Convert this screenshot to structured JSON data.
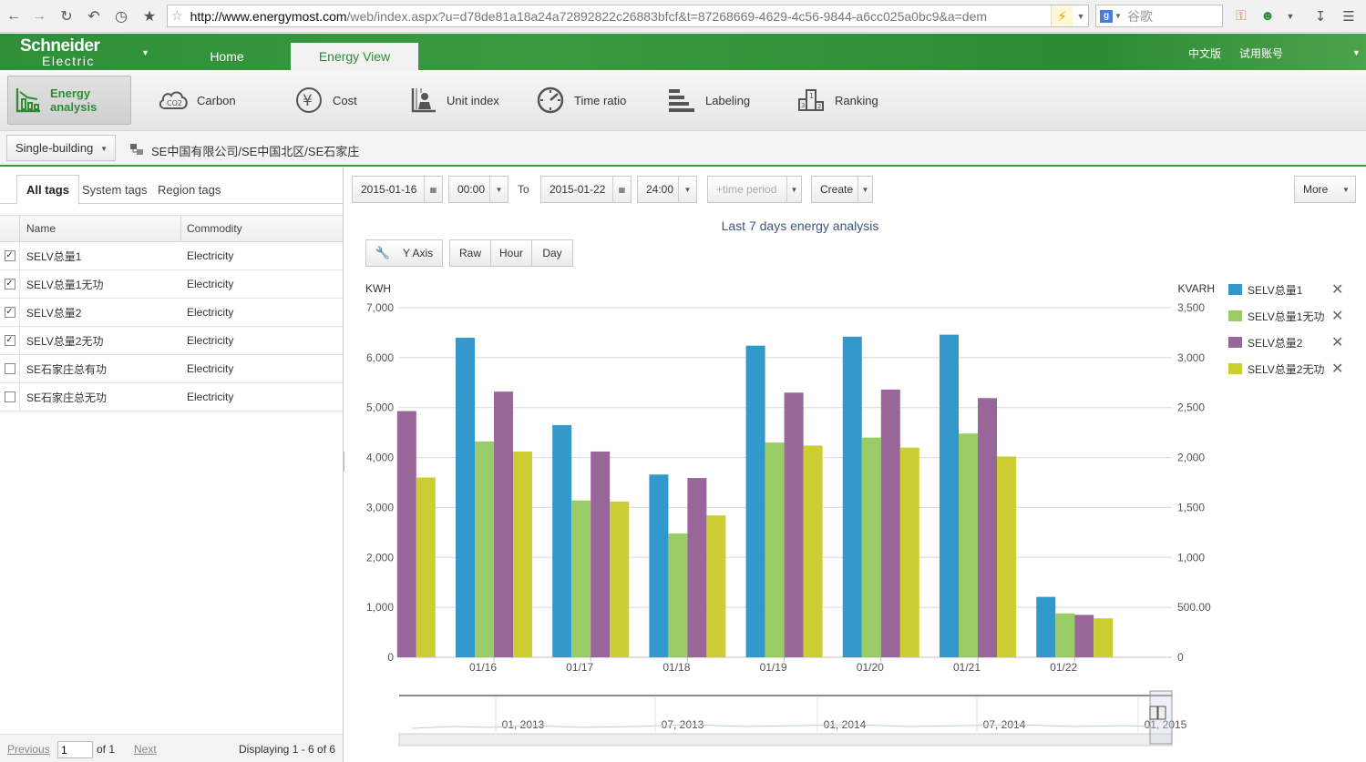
{
  "browser": {
    "url_host": "http://www.energymost.com",
    "url_rest": "/web/index.aspx?u=d78de81a18a24a72892822c26883bfcf&t=87268669-4629-4c56-9844-a6cc025a0bc9&a=dem",
    "search_placeholder": "谷歌"
  },
  "header": {
    "logo_line1": "Schneider",
    "logo_line2": "Electric",
    "tabs": [
      {
        "label": "Home"
      },
      {
        "label": "Energy View"
      }
    ],
    "lang_link": "中文版",
    "account_link": "试用账号"
  },
  "modules": [
    {
      "label": "Energy analysis",
      "icon": "energy-analysis-icon"
    },
    {
      "label": "Carbon",
      "icon": "co2-icon"
    },
    {
      "label": "Cost",
      "icon": "yen-icon"
    },
    {
      "label": "Unit index",
      "icon": "unit-index-icon"
    },
    {
      "label": "Time ratio",
      "icon": "time-ratio-icon"
    },
    {
      "label": "Labeling",
      "icon": "labeling-icon"
    },
    {
      "label": "Ranking",
      "icon": "ranking-icon"
    }
  ],
  "building": {
    "selector": "Single-building",
    "path": "SE中国有限公司/SE中国北区/SE石家庄"
  },
  "tag_tabs": [
    {
      "label": "All tags"
    },
    {
      "label": "System tags"
    },
    {
      "label": "Region tags"
    }
  ],
  "tag_table": {
    "col_name": "Name",
    "col_commodity": "Commodity",
    "rows": [
      {
        "name": "SELV总量1",
        "commodity": "Electricity",
        "checked": true
      },
      {
        "name": "SELV总量1无功",
        "commodity": "Electricity",
        "checked": true
      },
      {
        "name": "SELV总量2",
        "commodity": "Electricity",
        "checked": true
      },
      {
        "name": "SELV总量2无功",
        "commodity": "Electricity",
        "checked": true
      },
      {
        "name": "SE石家庄总有功",
        "commodity": "Electricity",
        "checked": false
      },
      {
        "name": "SE石家庄总无功",
        "commodity": "Electricity",
        "checked": false
      }
    ]
  },
  "pager": {
    "previous": "Previous",
    "page": "1",
    "of": "of 1",
    "next": "Next",
    "displaying": "Displaying 1 - 6 of 6"
  },
  "filters": {
    "start_date": "2015-01-16",
    "start_time": "00:00",
    "to": "To",
    "end_date": "2015-01-22",
    "end_time": "24:00",
    "time_period": "+time period",
    "create": "Create",
    "more": "More"
  },
  "chart_controls": {
    "y_axis": "Y Axis",
    "granularity": [
      "Raw",
      "Hour",
      "Day"
    ]
  },
  "chart_data": {
    "type": "bar",
    "title": "Last 7 days energy analysis",
    "categories": [
      "01/16",
      "01/17",
      "01/18",
      "01/19",
      "01/20",
      "01/21",
      "01/22"
    ],
    "ylabel_left": "KWH",
    "ylabel_right": "KVARH",
    "ylim_left": [
      0,
      7000
    ],
    "ylim_right": [
      0,
      3500
    ],
    "yticks_left": [
      "0",
      "1,000",
      "2,000",
      "3,000",
      "4,000",
      "5,000",
      "6,000",
      "7,000"
    ],
    "yticks_right": [
      "0",
      "500.00",
      "1,000",
      "1,500",
      "2,000",
      "2,500",
      "3,000",
      "3,500"
    ],
    "first_partial": {
      "series_values": {
        "SELV总量2": 4930,
        "SELV总量2无功": 1800
      }
    },
    "series": [
      {
        "name": "SELV总量1",
        "axis": "left",
        "color": "#3399cc",
        "values": [
          6400,
          4650,
          3660,
          6240,
          6420,
          6460,
          1210
        ]
      },
      {
        "name": "SELV总量1无功",
        "axis": "right",
        "color": "#99cc66",
        "values": [
          2160,
          1570,
          1240,
          2150,
          2200,
          2240,
          440
        ]
      },
      {
        "name": "SELV总量2",
        "axis": "left",
        "color": "#996699",
        "values": [
          5320,
          4120,
          3590,
          5300,
          5360,
          5190,
          850
        ]
      },
      {
        "name": "SELV总量2无功",
        "axis": "right",
        "color": "#cccc33",
        "values": [
          2060,
          1560,
          1420,
          2120,
          2100,
          2010,
          390
        ]
      }
    ],
    "grid": true,
    "legend_position": "right",
    "navigator_labels": [
      "01, 2013",
      "07, 2013",
      "01, 2014",
      "07, 2014",
      "01, 2015"
    ]
  }
}
